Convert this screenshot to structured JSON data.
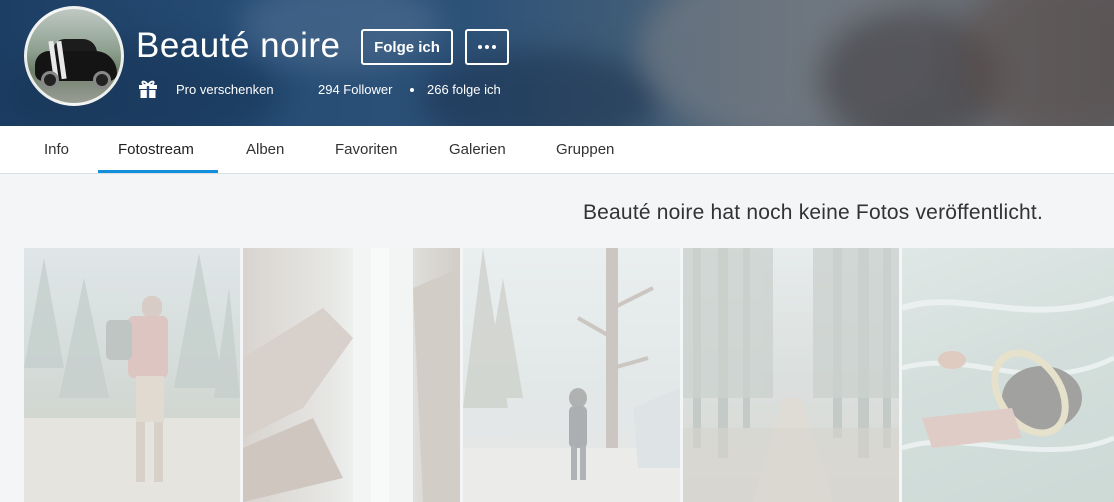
{
  "profile": {
    "name": "Beauté noire",
    "follow_label": "Folge ich",
    "more_label": "•••",
    "gift_label": "Pro verschenken",
    "followers": "294 Follower",
    "following": "266 folge ich",
    "avatar_icon": "car-avatar"
  },
  "tabs": [
    {
      "label": "Info",
      "active": false
    },
    {
      "label": "Fotostream",
      "active": true
    },
    {
      "label": "Alben",
      "active": false
    },
    {
      "label": "Favoriten",
      "active": false
    },
    {
      "label": "Galerien",
      "active": false
    },
    {
      "label": "Gruppen",
      "active": false
    }
  ],
  "main": {
    "empty_message": "Beauté noire hat noch keine Fotos veröffentlicht."
  },
  "colors": {
    "accent": "#128fdc",
    "page_bg": "#f3f5f6"
  }
}
